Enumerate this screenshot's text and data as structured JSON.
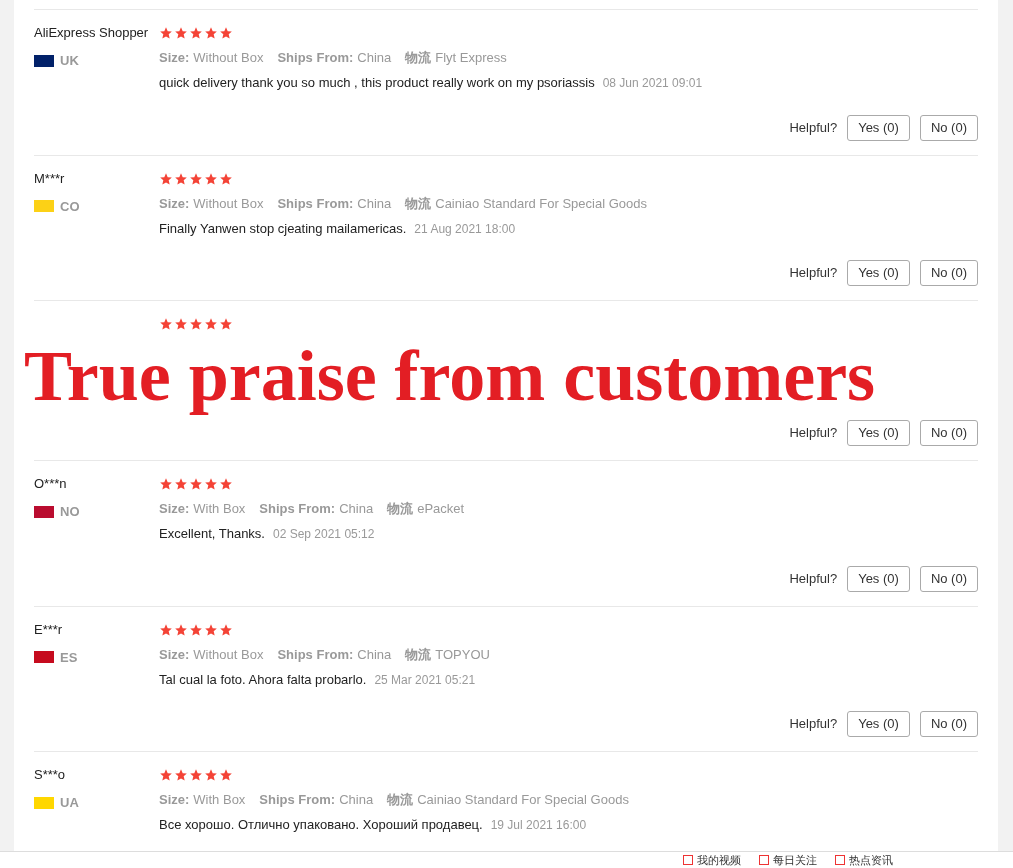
{
  "reviews": [
    {
      "name": "AliExpress Shopper",
      "color": "#012169",
      "country": "UK",
      "stars": 5,
      "meta": [
        {
          "label": "Size:",
          "value": "Without Box"
        },
        {
          "label": "Ships From:",
          "value": "China"
        },
        {
          "label": "物流",
          "value": "Flyt Express"
        }
      ],
      "comment": "quick delivery thank you so much , this product really work on my psoriassis",
      "date": "08 Jun 2021 09:01",
      "helpful": "Helpful?",
      "yes": "Yes (0)",
      "no": "No (0)"
    },
    {
      "name": "M***r",
      "color": "#fcd116",
      "country": "CO",
      "stars": 5,
      "meta": [
        {
          "label": "Size:",
          "value": "Without Box"
        },
        {
          "label": "Ships From:",
          "value": "China"
        },
        {
          "label": "物流",
          "value": "Cainiao Standard For Special Goods"
        }
      ],
      "comment": "Finally Yanwen stop cjeating mailamericas.",
      "date": "21 Aug 2021 18:00",
      "helpful": "Helpful?",
      "yes": "Yes (0)",
      "no": "No (0)"
    },
    {
      "stars": 5,
      "helpful": "Helpful?",
      "yes": "Yes (0)",
      "no": "No (0)"
    },
    {
      "name": "O***n",
      "color": "#ba0c2f",
      "country": "NO",
      "stars": 5,
      "meta": [
        {
          "label": "Size:",
          "value": "With Box"
        },
        {
          "label": "Ships From:",
          "value": "China"
        },
        {
          "label": "物流",
          "value": "ePacket"
        }
      ],
      "comment": "Excellent, Thanks.",
      "date": "02 Sep 2021 05:12",
      "helpful": "Helpful?",
      "yes": "Yes (0)",
      "no": "No (0)"
    },
    {
      "name": "E***r",
      "color": "#c60b1e",
      "country": "ES",
      "stars": 5,
      "meta": [
        {
          "label": "Size:",
          "value": "Without Box"
        },
        {
          "label": "Ships From:",
          "value": "China"
        },
        {
          "label": "物流",
          "value": "TOPYOU"
        }
      ],
      "comment": "Tal cual la foto. Ahora falta probarlo.",
      "date": "25 Mar 2021 05:21",
      "helpful": "Helpful?",
      "yes": "Yes (0)",
      "no": "No (0)"
    },
    {
      "name": "S***o",
      "color": "#ffd700",
      "country": "UA",
      "stars": 5,
      "meta": [
        {
          "label": "Size:",
          "value": "With Box"
        },
        {
          "label": "Ships From:",
          "value": "China"
        },
        {
          "label": "物流",
          "value": "Cainiao Standard For Special Goods"
        }
      ],
      "comment": "Все хорошо. Отлично упаковано. Хороший продавец.",
      "date": "19 Jul 2021 16:00"
    }
  ],
  "overlay_caption": "True praise from customers",
  "browser_bar": [
    "我的视频",
    "每日关注",
    "热点资讯"
  ]
}
